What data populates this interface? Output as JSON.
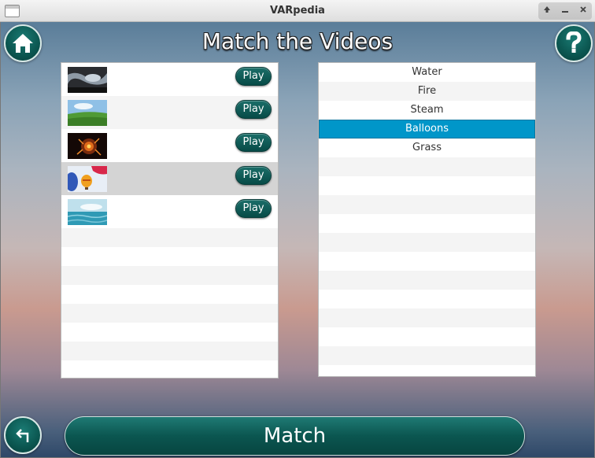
{
  "window": {
    "title": "VARpedia"
  },
  "page": {
    "title": "Match the Videos"
  },
  "icons": {
    "home": "home-icon",
    "help": "question-mark-icon",
    "back": "back-arrow-icon"
  },
  "videos": [
    {
      "thumbnail": "water-splash-thumbnail",
      "play_label": "Play",
      "selected": false
    },
    {
      "thumbnail": "grass-field-thumbnail",
      "play_label": "Play",
      "selected": false
    },
    {
      "thumbnail": "fire-thumbnail",
      "play_label": "Play",
      "selected": false
    },
    {
      "thumbnail": "hot-air-balloons-thumbnail",
      "play_label": "Play",
      "selected": true
    },
    {
      "thumbnail": "ocean-steam-thumbnail",
      "play_label": "Play",
      "selected": false
    }
  ],
  "words": [
    {
      "label": "Water",
      "selected": false
    },
    {
      "label": "Fire",
      "selected": false
    },
    {
      "label": "Steam",
      "selected": false
    },
    {
      "label": "Balloons",
      "selected": true
    },
    {
      "label": "Grass",
      "selected": false
    }
  ],
  "match_label": "Match",
  "colors": {
    "accent": "#0b5650",
    "selection": "#0096c9"
  }
}
